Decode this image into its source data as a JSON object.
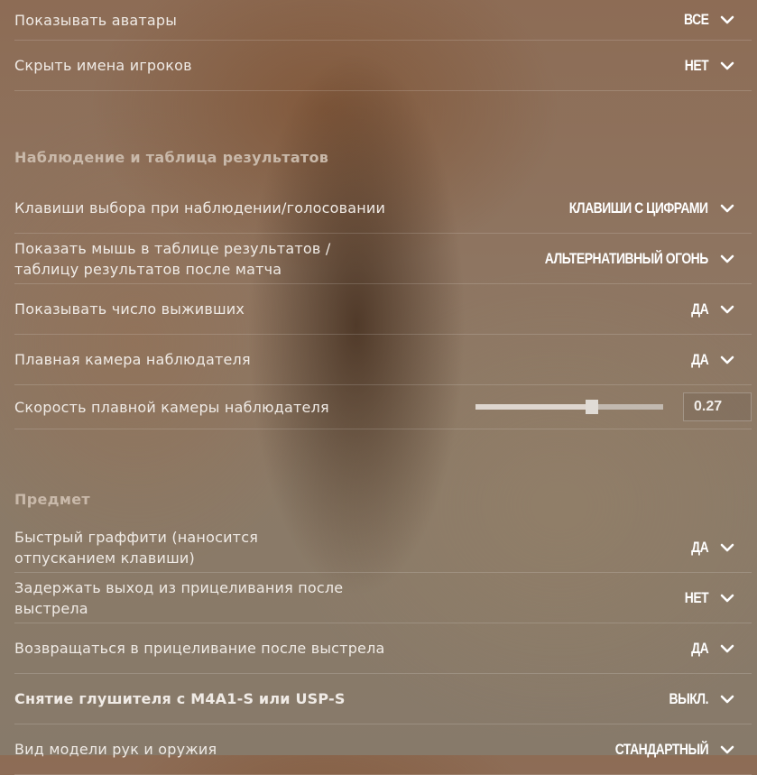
{
  "rows_top": [
    {
      "label": "Показывать аватары",
      "value": "ВСЕ"
    },
    {
      "label": "Скрыть имена игроков",
      "value": "НЕТ"
    }
  ],
  "section_spectate": {
    "title": "Наблюдение и таблица результатов",
    "rows": [
      {
        "label": "Клавиши выбора при наблюдении/голосовании",
        "value": "КЛАВИШИ С ЦИФРАМИ"
      },
      {
        "label": "Показать мышь в таблице результатов / таблицу результатов после матча",
        "value": "АЛЬТЕРНАТИВНЫЙ ОГОНЬ"
      },
      {
        "label": "Показывать число выживших",
        "value": "ДА"
      },
      {
        "label": "Плавная камера наблюдателя",
        "value": "ДА"
      }
    ],
    "slider": {
      "label": "Скорость плавной камеры наблюдателя",
      "value": "0.27",
      "fill_fraction": 0.62
    }
  },
  "section_item": {
    "title": "Предмет",
    "rows": [
      {
        "label": "Быстрый граффити (наносится отпусканием клавиши)",
        "value": "ДА"
      },
      {
        "label": "Задержать выход из прицеливания после выстрела",
        "value": "НЕТ"
      },
      {
        "label": "Возвращаться в прицеливание после выстрела",
        "value": "ДА"
      },
      {
        "label": "Снятие глушителя с M4A1-S или USP-S",
        "value": "ВЫКЛ."
      },
      {
        "label": "Вид модели рук и оружия",
        "value": "СТАНДАРТНЫЙ"
      }
    ]
  },
  "icons": {
    "dropdown": "chevron-down-icon"
  }
}
